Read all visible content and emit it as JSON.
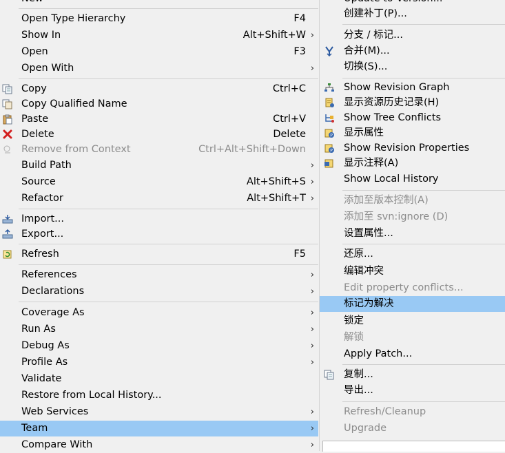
{
  "left_menu": {
    "items": [
      {
        "label": "New",
        "shortcut": "",
        "arrow": ""
      },
      {
        "label": "Open Type Hierarchy",
        "shortcut": "F4",
        "arrow": ""
      },
      {
        "label": "Show In",
        "shortcut": "Alt+Shift+W",
        "arrow": "›"
      },
      {
        "label": "Open",
        "shortcut": "F3",
        "arrow": ""
      },
      {
        "label": "Open With",
        "shortcut": "",
        "arrow": "›"
      },
      {
        "label": "Copy",
        "shortcut": "Ctrl+C",
        "arrow": ""
      },
      {
        "label": "Copy Qualified Name",
        "shortcut": "",
        "arrow": ""
      },
      {
        "label": "Paste",
        "shortcut": "Ctrl+V",
        "arrow": ""
      },
      {
        "label": "Delete",
        "shortcut": "Delete",
        "arrow": ""
      },
      {
        "label": "Remove from Context",
        "shortcut": "Ctrl+Alt+Shift+Down",
        "arrow": ""
      },
      {
        "label": "Build Path",
        "shortcut": "",
        "arrow": "›"
      },
      {
        "label": "Source",
        "shortcut": "Alt+Shift+S",
        "arrow": "›"
      },
      {
        "label": "Refactor",
        "shortcut": "Alt+Shift+T",
        "arrow": "›"
      },
      {
        "label": "Import...",
        "shortcut": "",
        "arrow": ""
      },
      {
        "label": "Export...",
        "shortcut": "",
        "arrow": ""
      },
      {
        "label": "Refresh",
        "shortcut": "F5",
        "arrow": ""
      },
      {
        "label": "References",
        "shortcut": "",
        "arrow": "›"
      },
      {
        "label": "Declarations",
        "shortcut": "",
        "arrow": "›"
      },
      {
        "label": "Coverage As",
        "shortcut": "",
        "arrow": "›"
      },
      {
        "label": "Run As",
        "shortcut": "",
        "arrow": "›"
      },
      {
        "label": "Debug As",
        "shortcut": "",
        "arrow": "›"
      },
      {
        "label": "Profile As",
        "shortcut": "",
        "arrow": "›"
      },
      {
        "label": "Validate",
        "shortcut": "",
        "arrow": ""
      },
      {
        "label": "Restore from Local History...",
        "shortcut": "",
        "arrow": ""
      },
      {
        "label": "Web Services",
        "shortcut": "",
        "arrow": "›"
      },
      {
        "label": "Team",
        "shortcut": "",
        "arrow": "›"
      },
      {
        "label": "Compare With",
        "shortcut": "",
        "arrow": "›"
      }
    ]
  },
  "right_menu": {
    "items": [
      {
        "label": "Update to Version..."
      },
      {
        "label": "创建补丁(P)..."
      },
      {
        "label": "分支 / 标记..."
      },
      {
        "label": "合并(M)..."
      },
      {
        "label": "切换(S)..."
      },
      {
        "label": "Show Revision Graph"
      },
      {
        "label": "显示资源历史记录(H)"
      },
      {
        "label": "Show Tree Conflicts"
      },
      {
        "label": "显示属性"
      },
      {
        "label": "Show Revision Properties"
      },
      {
        "label": "显示注释(A)"
      },
      {
        "label": "Show Local History"
      },
      {
        "label": "添加至版本控制(A)"
      },
      {
        "label": "添加至 svn:ignore (D)"
      },
      {
        "label": "设置属性..."
      },
      {
        "label": "还原..."
      },
      {
        "label": "编辑冲突"
      },
      {
        "label": "Edit property conflicts..."
      },
      {
        "label": "标记为解决"
      },
      {
        "label": "锁定"
      },
      {
        "label": "解锁"
      },
      {
        "label": "Apply Patch..."
      },
      {
        "label": "复制..."
      },
      {
        "label": "导出..."
      },
      {
        "label": "Refresh/Cleanup"
      },
      {
        "label": "Upgrade"
      }
    ]
  },
  "colors": {
    "menu_bg": "#f0f0f0",
    "highlight": "#99c9f4",
    "disabled_text": "#8c8c8c",
    "separator": "#d0d0d0"
  }
}
